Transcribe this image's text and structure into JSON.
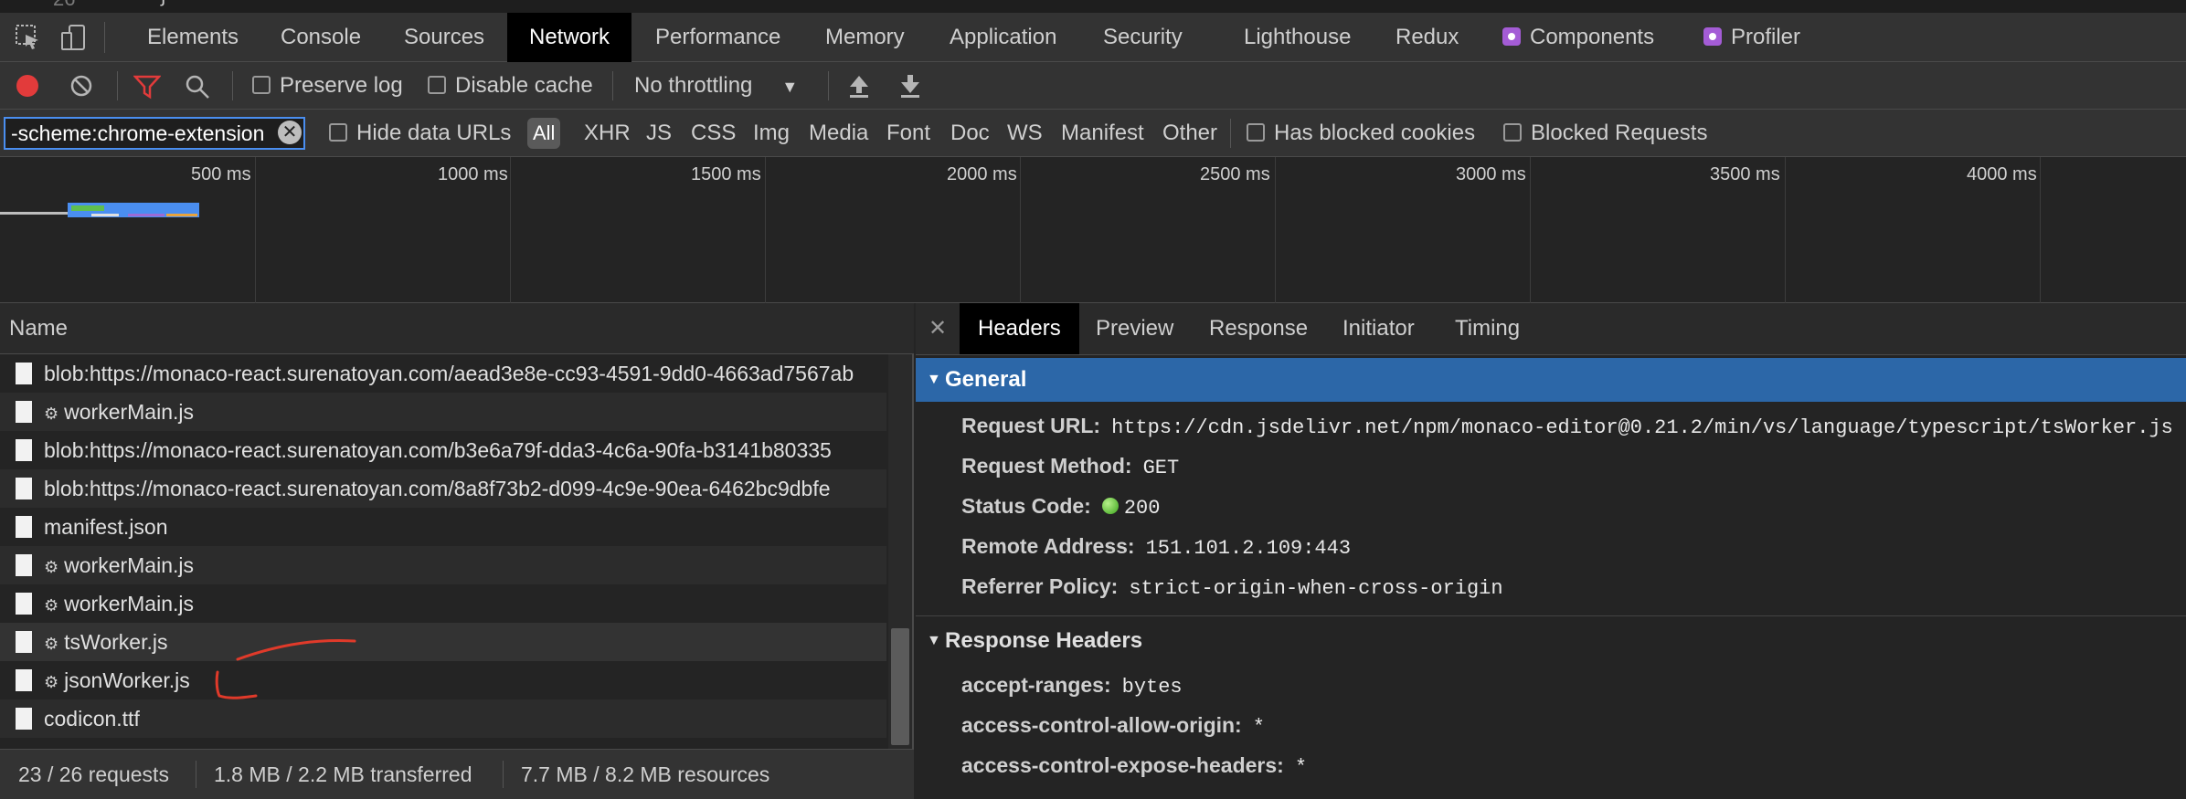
{
  "editor_remnant": {
    "line_number": "26",
    "brace": "}"
  },
  "main_tabs": [
    {
      "label": "Elements"
    },
    {
      "label": "Console"
    },
    {
      "label": "Sources"
    },
    {
      "label": "Network",
      "active": true
    },
    {
      "label": "Performance"
    },
    {
      "label": "Memory"
    },
    {
      "label": "Application"
    },
    {
      "label": "Security"
    },
    {
      "label": "Lighthouse"
    },
    {
      "label": "Redux"
    },
    {
      "label": "Components",
      "icon": "react-icon"
    },
    {
      "label": "Profiler",
      "icon": "react-icon"
    }
  ],
  "toolbar": {
    "preserve_log": "Preserve log",
    "disable_cache": "Disable cache",
    "throttling": "No throttling"
  },
  "filter": {
    "value": "-scheme:chrome-extension",
    "hide_data_urls": "Hide data URLs",
    "types": [
      "All",
      "XHR",
      "JS",
      "CSS",
      "Img",
      "Media",
      "Font",
      "Doc",
      "WS",
      "Manifest",
      "Other"
    ],
    "has_blocked_cookies": "Has blocked cookies",
    "blocked_requests": "Blocked Requests"
  },
  "timeline": {
    "ticks": [
      "500 ms",
      "1000 ms",
      "1500 ms",
      "2000 ms",
      "2500 ms",
      "3000 ms",
      "3500 ms",
      "4000 ms"
    ]
  },
  "requests": {
    "header": "Name",
    "rows": [
      {
        "name": "blob:https://monaco-react.surenatoyan.com/aead3e8e-cc93-4591-9dd0-4663ad7567ab",
        "gear": false
      },
      {
        "name": "workerMain.js",
        "gear": true
      },
      {
        "name": "blob:https://monaco-react.surenatoyan.com/b3e6a79f-dda3-4c6a-90fa-b3141b80335",
        "gear": false
      },
      {
        "name": "blob:https://monaco-react.surenatoyan.com/8a8f73b2-d099-4c9e-90ea-6462bc9dbfe",
        "gear": false
      },
      {
        "name": "manifest.json",
        "gear": false
      },
      {
        "name": "workerMain.js",
        "gear": true
      },
      {
        "name": "workerMain.js",
        "gear": true
      },
      {
        "name": "tsWorker.js",
        "gear": true
      },
      {
        "name": "jsonWorker.js",
        "gear": true
      },
      {
        "name": "codicon.ttf",
        "gear": false
      }
    ]
  },
  "status": {
    "requests": "23 / 26 requests",
    "transferred": "1.8 MB / 2.2 MB transferred",
    "resources": "7.7 MB / 8.2 MB resources"
  },
  "detail_tabs": [
    "Headers",
    "Preview",
    "Response",
    "Initiator",
    "Timing"
  ],
  "general": {
    "title": "General",
    "request_url_label": "Request URL:",
    "request_url": "https://cdn.jsdelivr.net/npm/monaco-editor@0.21.2/min/vs/language/typescript/tsWorker.js",
    "request_method_label": "Request Method:",
    "request_method": "GET",
    "status_code_label": "Status Code:",
    "status_code": "200",
    "remote_address_label": "Remote Address:",
    "remote_address": "151.101.2.109:443",
    "referrer_policy_label": "Referrer Policy:",
    "referrer_policy": "strict-origin-when-cross-origin"
  },
  "response_headers": {
    "title": "Response Headers",
    "accept_ranges_label": "accept-ranges:",
    "accept_ranges": "bytes",
    "acao_label": "access-control-allow-origin:",
    "acao": "*",
    "aceh_label": "access-control-expose-headers:",
    "aceh": "*"
  },
  "colors": {
    "accent": "#2c67a8",
    "record": "#e23b3b",
    "filter_active": "#e23b3b",
    "annotation": "#e03a2a"
  }
}
